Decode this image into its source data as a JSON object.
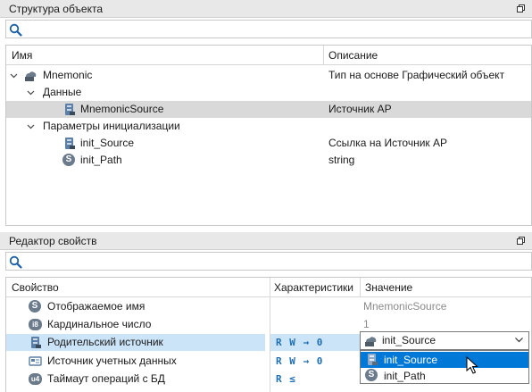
{
  "object_structure": {
    "title": "Структура объекта",
    "search_placeholder": "",
    "columns": {
      "name": "Имя",
      "description": "Описание"
    },
    "rows": [
      {
        "name": "Mnemonic",
        "description": "Тип на основе Графический объект",
        "icon": "graphic-object-icon",
        "expanded": true
      },
      {
        "name": "Данные",
        "description": "",
        "icon": "",
        "expanded": true
      },
      {
        "name": "MnemonicSource",
        "description": "Источник AP",
        "icon": "source-icon",
        "selected": true
      },
      {
        "name": "Параметры инициализации",
        "description": "",
        "icon": "",
        "expanded": true
      },
      {
        "name": "init_Source",
        "description": "Ссылка на Источник AP",
        "icon": "source-icon"
      },
      {
        "name": "init_Path",
        "description": "string",
        "icon": "string-type-icon",
        "icon_letter": "S"
      }
    ]
  },
  "property_editor": {
    "title": "Редактор свойств",
    "search_placeholder": "",
    "columns": {
      "property": "Свойство",
      "characteristics": "Характеристики",
      "value": "Значение"
    },
    "rows": [
      {
        "name": "Отображаемое имя",
        "characteristics": "",
        "value": "MnemonicSource",
        "icon": "string-type-icon",
        "icon_letter": "S"
      },
      {
        "name": "Кардинальное число",
        "characteristics": "",
        "value": "1",
        "icon": "int8-type-icon",
        "icon_letter": "i8"
      },
      {
        "name": "Родительский источник",
        "characteristics": "R W → 0",
        "value": "init_Source",
        "icon": "source-icon"
      },
      {
        "name": "Источник учетных данных",
        "characteristics": "R W → 0",
        "value": "",
        "icon": "credentials-icon"
      },
      {
        "name": "Таймаут операций с БД",
        "characteristics": "R ≤",
        "value": "",
        "icon": "uint4-type-icon",
        "icon_letter": "u4"
      }
    ],
    "dropdown": {
      "selected": "init_Source",
      "options": [
        {
          "label": "init_Source",
          "icon": "source-icon",
          "active": true
        },
        {
          "label": "init_Path",
          "icon": "string-type-icon",
          "icon_letter": "S"
        }
      ]
    }
  },
  "colors": {
    "selection_grey": "#d9d9d9",
    "row_highlight": "#cce4f7",
    "dropdown_active": "#0078d7",
    "icon_grey": "#6b7b8c",
    "accent_blue": "#1f6fb5"
  }
}
